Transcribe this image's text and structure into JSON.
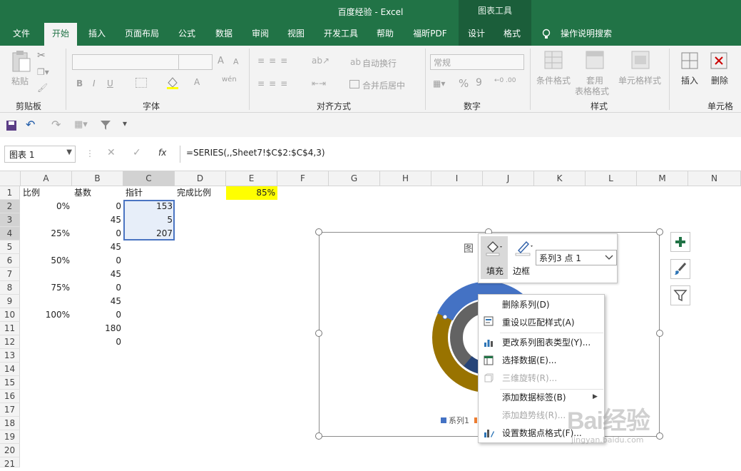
{
  "window": {
    "title": "百度经验  -  Excel",
    "context_tab_group": "图表工具"
  },
  "tabs": [
    "文件",
    "开始",
    "插入",
    "页面布局",
    "公式",
    "数据",
    "审阅",
    "视图",
    "开发工具",
    "帮助",
    "福昕PDF",
    "设计",
    "格式"
  ],
  "tell_me": "操作说明搜索",
  "ribbon": {
    "clipboard": {
      "label": "剪贴板",
      "paste": "粘贴"
    },
    "font": {
      "label": "字体",
      "bold": "B",
      "italic": "I",
      "underline": "U",
      "font_color": "A",
      "wen": "wén",
      "grow": "A",
      "shrink": "A"
    },
    "alignment": {
      "label": "对齐方式",
      "wrap": "自动换行",
      "merge": "合并后居中"
    },
    "number": {
      "label": "数字",
      "format": "常规",
      "percent": "%",
      "comma": "9"
    },
    "styles": {
      "label": "样式",
      "conditional": "条件格式",
      "table_line1": "套用",
      "table_line2": "表格格式",
      "cell_styles": "单元格样式"
    },
    "cells": {
      "label": "单元格",
      "insert": "插入",
      "delete": "删除"
    }
  },
  "name_box": "图表 1",
  "formula_bar": {
    "fx": "fx",
    "formula": "=SERIES(,,Sheet7!$C$2:$C$4,3)"
  },
  "columns": [
    "A",
    "B",
    "C",
    "D",
    "E",
    "F",
    "G",
    "H",
    "I",
    "J",
    "K",
    "L",
    "M",
    "N"
  ],
  "rows": [
    "1",
    "2",
    "3",
    "4",
    "5",
    "6",
    "7",
    "8",
    "9",
    "10",
    "11",
    "12",
    "13",
    "14",
    "15",
    "16",
    "17",
    "18",
    "19",
    "20",
    "21"
  ],
  "cells": {
    "A1": "比例",
    "B1": "基数",
    "C1": "指针",
    "D1": "完成比例",
    "E1": "85%",
    "A2": "0%",
    "B2": "0",
    "C2": "153",
    "B3": "45",
    "C3": "5",
    "A4": "25%",
    "B4": "0",
    "C4": "207",
    "B5": "45",
    "A6": "50%",
    "B6": "0",
    "B7": "45",
    "A8": "75%",
    "B8": "0",
    "B9": "45",
    "A10": "100%",
    "B10": "0",
    "B11": "180",
    "B12": "0"
  },
  "chart": {
    "title_visible": "图",
    "legend_item": "系列1"
  },
  "mini_toolbar": {
    "fill": "填充",
    "border": "边框",
    "selector": "系列3 点 1"
  },
  "context_menu": [
    {
      "label": "删除系列(D)",
      "disabled": false
    },
    {
      "label": "重设以匹配样式(A)",
      "disabled": false
    },
    {
      "label": "更改系列图表类型(Y)...",
      "disabled": false
    },
    {
      "label": "选择数据(E)...",
      "disabled": false
    },
    {
      "label": "三维旋转(R)...",
      "disabled": true
    },
    {
      "label": "添加数据标签(B)",
      "disabled": false
    },
    {
      "label": "添加趋势线(R)...",
      "disabled": true
    },
    {
      "label": "设置数据点格式(F)...",
      "disabled": false
    }
  ],
  "watermark": {
    "text": "Bai经验",
    "url": "jingyan.baidu.com"
  },
  "colors": {
    "excel_green": "#217346",
    "highlight_yellow": "#ffff00",
    "series_blue": "#4472c4",
    "series_orange": "#ed7d31",
    "series_gold": "#997300",
    "series_gray": "#636363",
    "series_navy": "#264478"
  }
}
